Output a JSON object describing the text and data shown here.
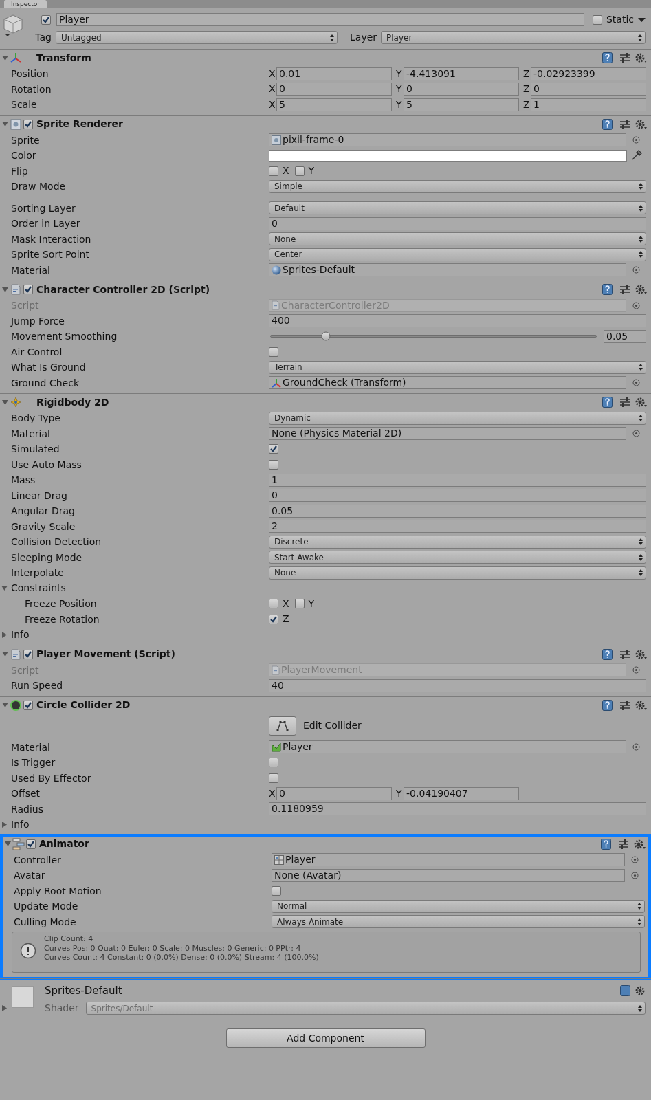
{
  "tab": {
    "label": "Inspector"
  },
  "object": {
    "active": true,
    "name": "Player",
    "static": false,
    "static_label": "Static",
    "tag_label": "Tag",
    "tag": "Untagged",
    "layer_label": "Layer",
    "layer": "Player"
  },
  "components": [
    {
      "title": "Transform",
      "expanded": true,
      "rows": [
        {
          "kind": "vector",
          "label": "Position",
          "axes": [
            {
              "axis": "X",
              "value": "0.01"
            },
            {
              "axis": "Y",
              "value": "-4.413091"
            },
            {
              "axis": "Z",
              "value": "-0.02923399"
            }
          ]
        },
        {
          "kind": "vector",
          "label": "Rotation",
          "axes": [
            {
              "axis": "X",
              "value": "0"
            },
            {
              "axis": "Y",
              "value": "0"
            },
            {
              "axis": "Z",
              "value": "0"
            }
          ]
        },
        {
          "kind": "vector",
          "label": "Scale",
          "axes": [
            {
              "axis": "X",
              "value": "5"
            },
            {
              "axis": "Y",
              "value": "5"
            },
            {
              "axis": "Z",
              "value": "1"
            }
          ]
        }
      ]
    },
    {
      "title": "Sprite Renderer",
      "enabled": true,
      "expanded": true,
      "rows": [
        {
          "kind": "object",
          "label": "Sprite",
          "value": "pixil-frame-0",
          "disabled": false
        },
        {
          "kind": "color",
          "label": "Color"
        },
        {
          "kind": "checks",
          "label": "Flip",
          "items": [
            {
              "label": "X",
              "checked": false
            },
            {
              "label": "Y",
              "checked": false
            }
          ]
        },
        {
          "kind": "dropdown",
          "label": "Draw Mode",
          "value": "Simple"
        },
        {
          "kind": "spacer"
        },
        {
          "kind": "dropdown",
          "label": "Sorting Layer",
          "value": "Default"
        },
        {
          "kind": "text",
          "label": "Order in Layer",
          "value": "0"
        },
        {
          "kind": "dropdown",
          "label": "Mask Interaction",
          "value": "None"
        },
        {
          "kind": "dropdown",
          "label": "Sprite Sort Point",
          "value": "Center"
        },
        {
          "kind": "object",
          "label": "Material",
          "value": "Sprites-Default",
          "disabled": false
        }
      ]
    },
    {
      "title": "Character Controller 2D (Script)",
      "enabled": true,
      "expanded": true,
      "rows": [
        {
          "kind": "object",
          "label": "Script",
          "value": "CharacterController2D",
          "disabled": true
        },
        {
          "kind": "text",
          "label": "Jump Force",
          "value": "400"
        },
        {
          "kind": "slider",
          "label": "Movement Smoothing",
          "level": 0.17,
          "value": "0.05"
        },
        {
          "kind": "checkbox",
          "label": "Air Control",
          "checked": false
        },
        {
          "kind": "dropdown",
          "label": "What Is Ground",
          "value": "Terrain"
        },
        {
          "kind": "object",
          "label": "Ground Check",
          "value": "GroundCheck (Transform)",
          "disabled": false
        }
      ]
    },
    {
      "title": "Rigidbody 2D",
      "expanded": true,
      "rows": [
        {
          "kind": "dropdown",
          "label": "Body Type",
          "value": "Dynamic"
        },
        {
          "kind": "object",
          "label": "Material",
          "value": "None (Physics Material 2D)",
          "disabled": false
        },
        {
          "kind": "checkbox",
          "label": "Simulated",
          "checked": true
        },
        {
          "kind": "checkbox",
          "label": "Use Auto Mass",
          "checked": false
        },
        {
          "kind": "text",
          "label": "Mass",
          "value": "1"
        },
        {
          "kind": "text",
          "label": "Linear Drag",
          "value": "0"
        },
        {
          "kind": "text",
          "label": "Angular Drag",
          "value": "0.05"
        },
        {
          "kind": "text",
          "label": "Gravity Scale",
          "value": "2"
        },
        {
          "kind": "dropdown",
          "label": "Collision Detection",
          "value": "Discrete"
        },
        {
          "kind": "dropdown",
          "label": "Sleeping Mode",
          "value": "Start Awake"
        },
        {
          "kind": "dropdown",
          "label": "Interpolate",
          "value": "None"
        },
        {
          "kind": "foldout",
          "label": "Constraints",
          "expanded": true,
          "children": [
            {
              "kind": "checks",
              "label": "Freeze Position",
              "items": [
                {
                  "label": "X",
                  "checked": false
                },
                {
                  "label": "Y",
                  "checked": false
                }
              ]
            },
            {
              "kind": "checks",
              "label": "Freeze Rotation",
              "items": [
                {
                  "label": "Z",
                  "checked": true
                }
              ]
            }
          ]
        },
        {
          "kind": "foldout",
          "label": "Info",
          "expanded": false
        }
      ]
    },
    {
      "title": "Player Movement (Script)",
      "enabled": true,
      "expanded": true,
      "rows": [
        {
          "kind": "object",
          "label": "Script",
          "value": "PlayerMovement",
          "disabled": true
        },
        {
          "kind": "text",
          "label": "Run Speed",
          "value": "40"
        }
      ]
    },
    {
      "title": "Circle Collider 2D",
      "enabled": true,
      "expanded": true,
      "rows": [
        {
          "kind": "button",
          "label": "Edit Collider"
        },
        {
          "kind": "object",
          "label": "Material",
          "value": "Player",
          "disabled": false
        },
        {
          "kind": "checkbox",
          "label": "Is Trigger",
          "checked": false
        },
        {
          "kind": "checkbox",
          "label": "Used By Effector",
          "checked": false
        },
        {
          "kind": "vector",
          "label": "Offset",
          "axes": [
            {
              "axis": "X",
              "value": "0"
            },
            {
              "axis": "Y",
              "value": "-0.04190407"
            }
          ]
        },
        {
          "kind": "text",
          "label": "Radius",
          "value": "0.1180959"
        },
        {
          "kind": "foldout",
          "label": "Info",
          "expanded": false
        }
      ]
    },
    {
      "title": "Animator",
      "enabled": true,
      "expanded": true,
      "highlighted": true,
      "rows": [
        {
          "kind": "object",
          "label": "Controller",
          "value": "Player",
          "disabled": false
        },
        {
          "kind": "object",
          "label": "Avatar",
          "value": "None (Avatar)",
          "disabled": false
        },
        {
          "kind": "checkbox",
          "label": "Apply Root Motion",
          "checked": false
        },
        {
          "kind": "dropdown",
          "label": "Update Mode",
          "value": "Normal"
        },
        {
          "kind": "dropdown",
          "label": "Culling Mode",
          "value": "Always Animate"
        },
        {
          "kind": "info",
          "lines": [
            "Clip Count: 4",
            "Curves Pos: 0 Quat: 0 Euler: 0 Scale: 0 Muscles: 0 Generic: 0 PPtr: 4",
            "Curves Count: 4 Constant: 0 (0.0%) Dense: 0 (0.0%) Stream: 4 (100.0%)"
          ]
        }
      ]
    }
  ],
  "material": {
    "name": "Sprites-Default",
    "expanded": false,
    "shader_label": "Shader",
    "shader": "Sprites/Default"
  },
  "add_component": {
    "label": "Add Component"
  }
}
